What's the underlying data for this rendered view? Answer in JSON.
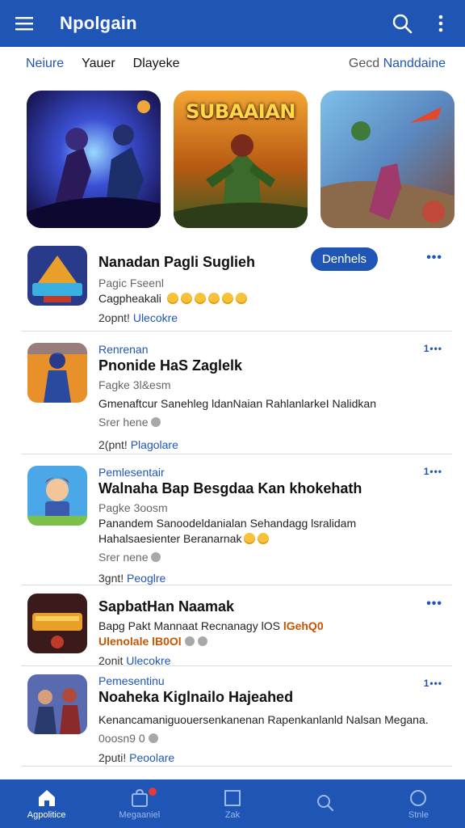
{
  "app": {
    "title": "Npolgain"
  },
  "icons": {
    "menu": "menu-icon",
    "search": "search-icon",
    "more": "more-vert-icon"
  },
  "tabs": [
    {
      "label": "Neiure",
      "active": true
    },
    {
      "label": "Yauer",
      "active": false
    },
    {
      "label": "Dlayeke",
      "active": false
    }
  ],
  "tabs_right": {
    "prefix": "Gecd",
    "highlight": "Nanddaine"
  },
  "featured": [
    {
      "banner": ""
    },
    {
      "banner": "SUBAAIAN"
    },
    {
      "banner": ""
    }
  ],
  "list": [
    {
      "category": "",
      "title": "Nanadan Pagli Suglieh",
      "line1": "Pagic Fseenl",
      "line2": "Cagpheakali",
      "line3": "",
      "foot_prefix": "2opnt!",
      "foot_link": "Ulecokre",
      "pill": "Denhels",
      "dots": "•••"
    },
    {
      "category": "Renrenan",
      "title": "Pnonide HaS Zaglelk",
      "line1": "Fagke 3l&esm",
      "line2": "Gmenaftcur Sanehleg ldanNaian RahlanlarkeI Nalidkan",
      "line3": "Srer hene",
      "foot_prefix": "2(pnt!",
      "foot_link": "Plagolare",
      "dots": "1•••"
    },
    {
      "category": "Pemlesentair",
      "title": "Walnaha Bap Besgdaa Kan khokehath",
      "line1": "Pagke 3oosm",
      "line2": "Panandem Sanoodeldanialan Sehandagg lsralidam",
      "line2b": "Hahalsaesienter Beranarnak",
      "line3": "Srer nene",
      "foot_prefix": "3gnt!",
      "foot_link": "Peoglre",
      "dots": "1•••"
    },
    {
      "category": "",
      "title": "SapbatHan Naamak",
      "line1": "Bapg Pakt Mannaat Recnanagy lOS",
      "line1_hl": "lGehQ0",
      "line2_hl": "Ulenolale lB0Ol",
      "line3": "",
      "foot_prefix": "2onit",
      "foot_link": "Ulecokre",
      "dots": "•••"
    },
    {
      "category": "Pemesentinu",
      "title": "Noaheka Kiglnailo Hajeahed",
      "line1": "",
      "line2": "Kenancamaniguouersenkanenan Rapenkanlanld Nalsan Megana.",
      "line3": "0oosn9 0",
      "foot_prefix": "2puti!",
      "foot_link": "Peoolare",
      "dots": "1•••"
    }
  ],
  "bottom_nav": [
    {
      "label": "Agpolitice",
      "icon": "home-icon",
      "active": true
    },
    {
      "label": "Megaaniel",
      "icon": "shopping-bag-icon",
      "active": false
    },
    {
      "label": "Zak",
      "icon": "square-icon",
      "active": false
    },
    {
      "label": "",
      "icon": "search-icon",
      "active": false
    },
    {
      "label": "Stnle",
      "icon": "circle-icon",
      "active": false
    }
  ],
  "colors": {
    "primary": "#1f56b6",
    "background": "#ffffff",
    "divider": "#dcdcdc"
  }
}
